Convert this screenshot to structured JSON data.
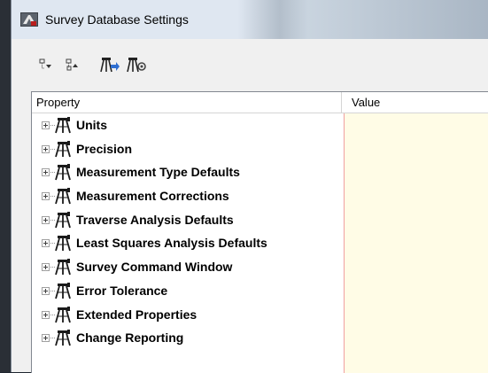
{
  "window": {
    "title": "Survey Database Settings",
    "app_icon": "civil3d-app-icon"
  },
  "toolbar": {
    "buttons": [
      {
        "name": "expand-all-button",
        "icon": "expand-all-icon"
      },
      {
        "name": "collapse-all-button",
        "icon": "collapse-all-icon"
      },
      {
        "name": "import-settings-button",
        "icon": "import-settings-icon"
      },
      {
        "name": "export-settings-button",
        "icon": "export-settings-icon"
      }
    ]
  },
  "grid": {
    "columns": [
      "Property",
      "Value"
    ],
    "rows": [
      {
        "label": "Units"
      },
      {
        "label": "Precision"
      },
      {
        "label": "Measurement Type Defaults"
      },
      {
        "label": "Measurement Corrections"
      },
      {
        "label": "Traverse Analysis Defaults"
      },
      {
        "label": "Least Squares Analysis Defaults"
      },
      {
        "label": "Survey Command Window"
      },
      {
        "label": "Error Tolerance"
      },
      {
        "label": "Extended Properties"
      },
      {
        "label": "Change Reporting"
      }
    ]
  },
  "colors": {
    "value_column_bg": "#fffce6",
    "grid_bg": "#ffffff",
    "window_bg": "#f0f0f0"
  }
}
